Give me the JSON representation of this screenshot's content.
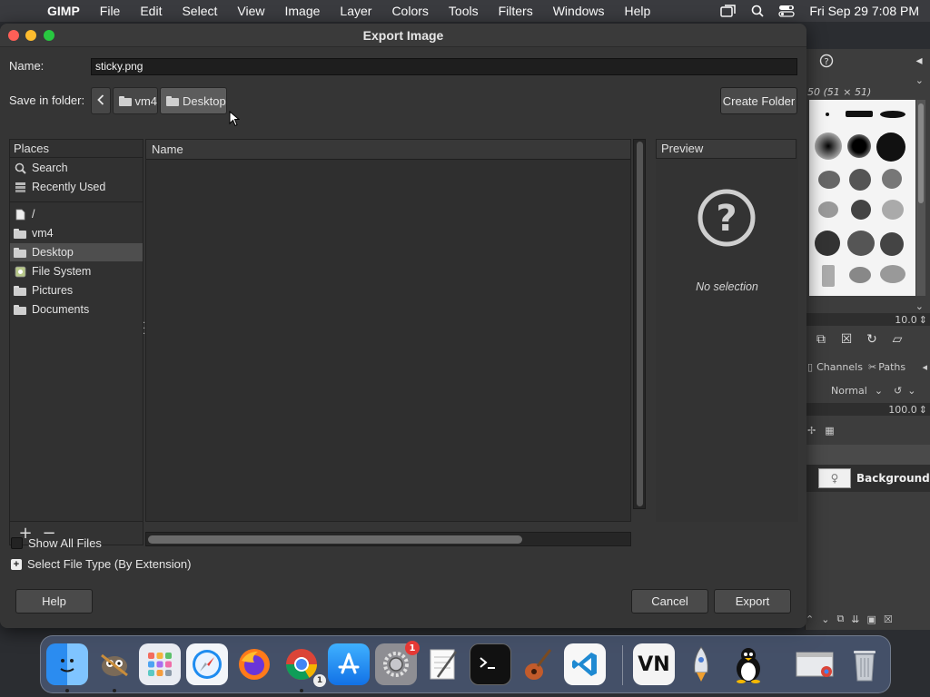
{
  "menubar": {
    "app": "GIMP",
    "items": [
      "File",
      "Edit",
      "Select",
      "View",
      "Image",
      "Layer",
      "Colors",
      "Tools",
      "Filters",
      "Windows",
      "Help"
    ],
    "clock": "Fri Sep 29  7:08 PM"
  },
  "dialog": {
    "title": "Export Image",
    "name_label": "Name:",
    "name_value": "sticky.png",
    "folder_label": "Save in folder:",
    "breadcrumbs": [
      "vm4",
      "Desktop"
    ],
    "create_folder": "Create Folder",
    "places": {
      "header": "Places",
      "items": [
        "Search",
        "Recently Used",
        "/",
        "vm4",
        "Desktop",
        "File System",
        "Pictures",
        "Documents"
      ],
      "selected": "Desktop"
    },
    "files": {
      "column_name": "Name"
    },
    "preview": {
      "header": "Preview",
      "empty_text": "No selection"
    },
    "show_all_files": "Show All Files",
    "file_type": "Select File Type (By Extension)",
    "help": "Help",
    "cancel": "Cancel",
    "export": "Export"
  },
  "gimp_panel": {
    "brush_info": "50 (51 × 51)",
    "brush_size": "10.0",
    "tabs": [
      "Channels",
      "Paths"
    ],
    "mode": "Normal",
    "opacity": "100.0",
    "layer_name": "Background"
  },
  "dock": {
    "settings_badge": "1",
    "chrome_badge": "1",
    "vn_label": "VN"
  }
}
